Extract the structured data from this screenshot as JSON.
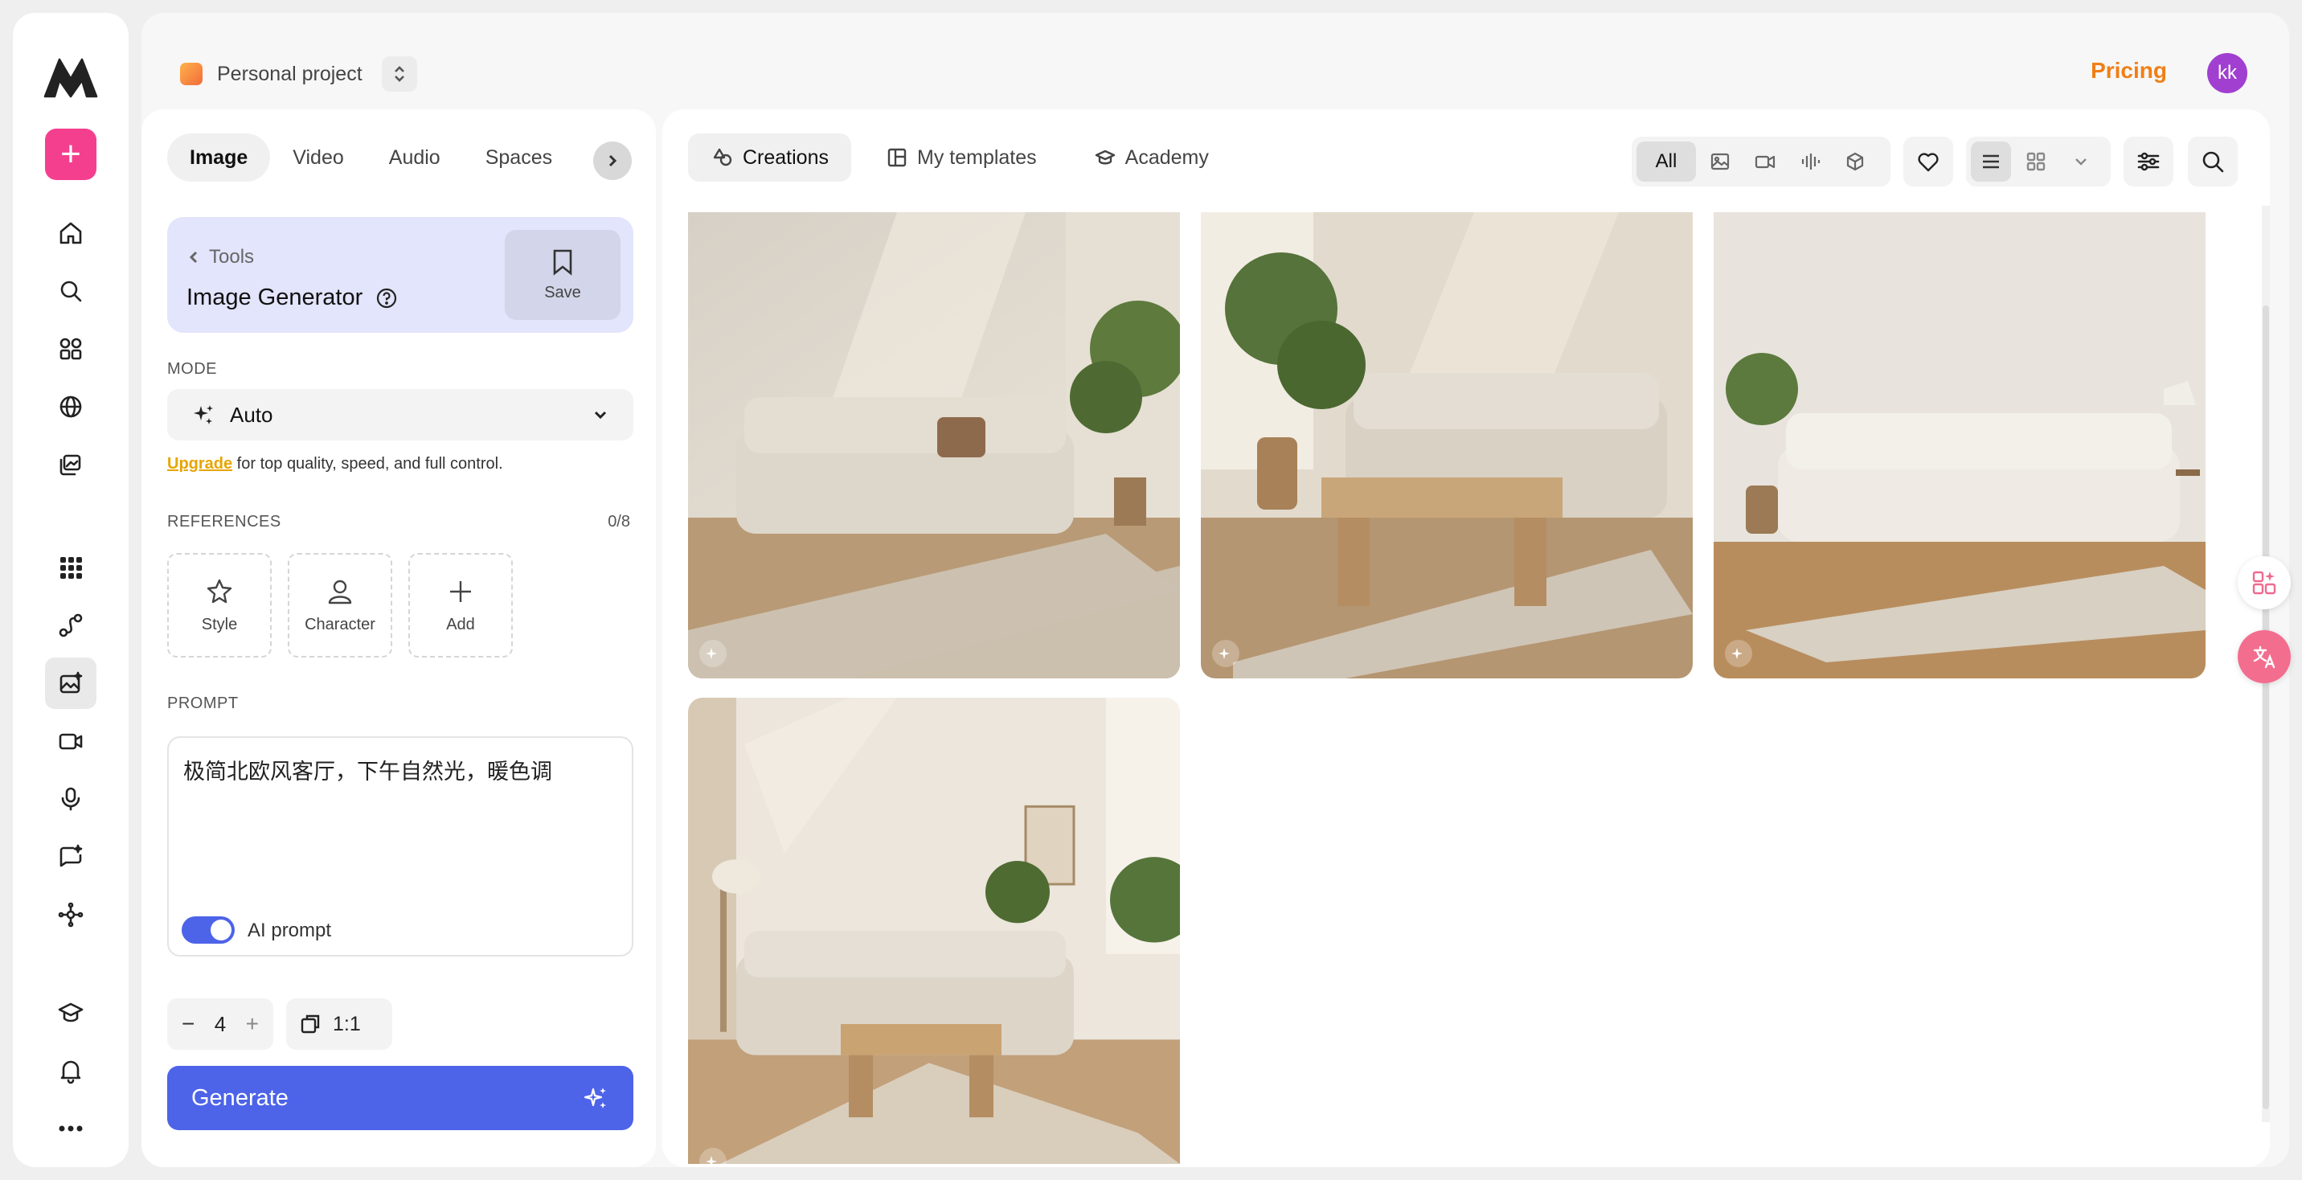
{
  "project": {
    "name": "Personal project"
  },
  "header": {
    "pricing": "Pricing",
    "avatar_initials": "kk",
    "accent": "#f07f16",
    "avatar_color": "#a13fd0"
  },
  "rail": {
    "icons": [
      "logo-icon",
      "plus-icon",
      "home-icon",
      "search-icon",
      "apps-icon",
      "globe-icon",
      "library-icon",
      "grid-dots-icon",
      "workflow-icon",
      "image-tool-icon",
      "video-tool-icon",
      "mic-icon",
      "chat-sparkle-icon",
      "nodes-icon",
      "academy-icon",
      "bell-icon",
      "more-icon"
    ]
  },
  "media_tabs": [
    "Image",
    "Video",
    "Audio",
    "Spaces"
  ],
  "tool": {
    "back": "Tools",
    "title": "Image Generator",
    "save": "Save"
  },
  "mode": {
    "label": "MODE",
    "value": "Auto"
  },
  "upgrade": {
    "link": "Upgrade",
    "text": " for top quality, speed, and full control."
  },
  "references": {
    "label": "REFERENCES",
    "count": "0/8",
    "items": [
      "Style",
      "Character",
      "Add"
    ]
  },
  "prompt": {
    "label": "PROMPT",
    "text": "极简北欧风客厅，下午自然光，暖色调",
    "ai_prompt": "AI prompt",
    "ai_prompt_on": true
  },
  "settings": {
    "quantity": "4",
    "ratio": "1:1"
  },
  "generate": {
    "label": "Generate",
    "color": "#4d63e8"
  },
  "content_tabs": [
    "Creations",
    "My templates",
    "Academy"
  ],
  "filters": {
    "all": "All",
    "types": [
      "image-icon",
      "video-icon",
      "audio-icon",
      "3d-icon"
    ]
  },
  "gallery": {
    "count": 4
  }
}
